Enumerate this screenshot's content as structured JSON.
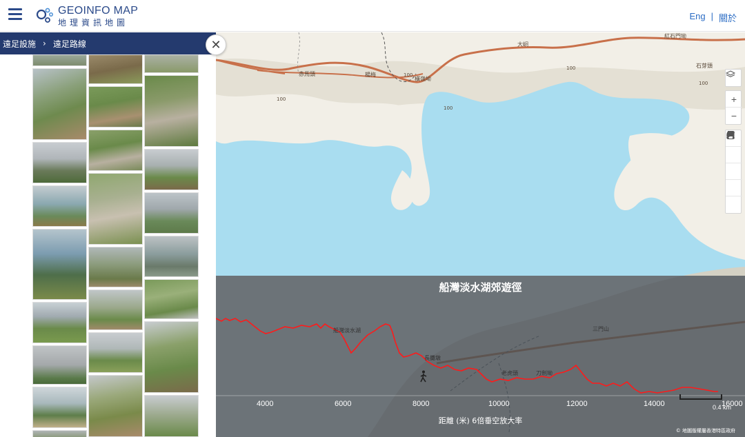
{
  "header": {
    "logo_en": "GEOINFO MAP",
    "logo_zh": "地理資訊地圖",
    "lang_eng": "Eng",
    "lang_sep": "|",
    "lang_about": "關於"
  },
  "breadcrumb": {
    "item1": "遠足設施",
    "sep": "›",
    "item2": "遠足路線"
  },
  "close_glyph": "✕",
  "map": {
    "labels": {
      "tai_tung": "大峒",
      "hung_shek_mun": "紅石門坳",
      "chek_mun_tau": "赤馬頭",
      "yeung_chau": "楊梅",
      "wang_mong": "橫嶺坳",
      "shek_au": "石芽頭",
      "contour_100a": "100",
      "contour_100b": "100",
      "contour_100c": "100",
      "contour_100d": "100",
      "contour_100e": "100"
    },
    "controls": [
      "layers-icon",
      "zoom-in-icon",
      "zoom-out-icon",
      "location-pin-icon",
      "ruler-icon",
      "share-icon",
      "print-icon",
      "fullscreen-icon"
    ],
    "zoom_in_glyph": "+",
    "zoom_out_glyph": "−",
    "colors": {
      "water": "#a9ddf0",
      "land": "#f2efe7",
      "hill": "#e4e0d4",
      "road": "#c8704a",
      "trail": "#ff1a1a",
      "panel": "rgba(70,80,88,0.78)"
    }
  },
  "profile": {
    "title": "船灣淡水湖郊遊徑",
    "x_axis_label": "距離 (米) 6倍垂空放大率",
    "ticks": [
      "4000",
      "6000",
      "8000",
      "10000",
      "12000",
      "14000",
      "16000"
    ],
    "scale_label": "0.4 km",
    "copyright": "© 地圖版權屬香港特區政府",
    "labels": {
      "reservoir": "船灣淡水湖",
      "cheung_pai": "長攤墩",
      "lo_fu_tau": "老虎頭",
      "do_kin": "刀劍坳",
      "sam_mun": "三門山"
    }
  }
}
